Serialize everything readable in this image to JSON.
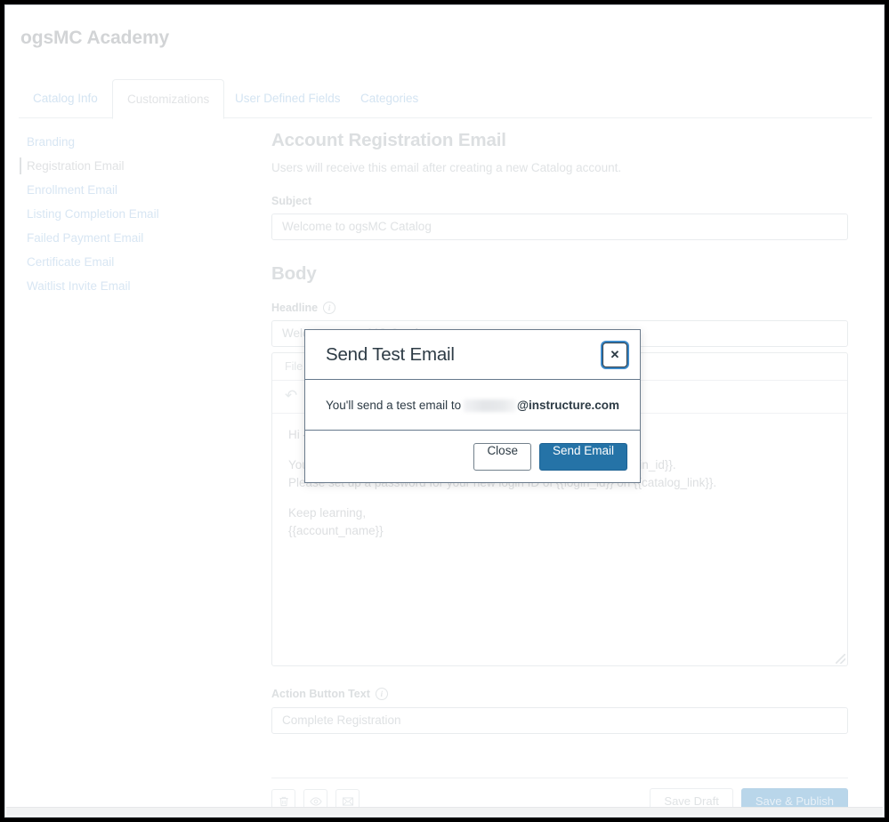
{
  "header": {
    "title": "ogsMC Academy"
  },
  "tabs": [
    {
      "label": "Catalog Info",
      "active": false
    },
    {
      "label": "Customizations",
      "active": true
    },
    {
      "label": "User Defined Fields",
      "active": false
    },
    {
      "label": "Categories",
      "active": false
    }
  ],
  "sidebar": {
    "items": [
      {
        "label": "Branding",
        "active": false
      },
      {
        "label": "Registration Email",
        "active": true
      },
      {
        "label": "Enrollment Email",
        "active": false
      },
      {
        "label": "Listing Completion Email",
        "active": false
      },
      {
        "label": "Failed Payment Email",
        "active": false
      },
      {
        "label": "Certificate Email",
        "active": false
      },
      {
        "label": "Waitlist Invite Email",
        "active": false
      }
    ]
  },
  "main": {
    "page_title": "Account Registration Email",
    "subtitle": "Users will receive this email after creating a new Catalog account.",
    "subject_label": "Subject",
    "subject_value": "Welcome to ogsMC Catalog",
    "body_heading": "Body",
    "headline_label": "Headline",
    "headline_value": "Welcome to ogsMC Catalog",
    "editor": {
      "menu_file": "File",
      "undo_icon": "undo-icon",
      "paragraphs": [
        "Hi {{user_name}},",
        "You have been enrolled in {{catalog_link}} with the login ID of {{login_id}}.\nPlease set up a password for your new login ID of {{login_id}} on {{catalog_link}}.",
        "Keep learning,\n{{account_name}}"
      ]
    },
    "action_button_label": "Action Button Text",
    "action_button_value": "Complete Registration"
  },
  "footer": {
    "icons": [
      {
        "name": "trash-icon"
      },
      {
        "name": "eye-icon"
      },
      {
        "name": "envelope-icon"
      }
    ],
    "save_draft_label": "Save Draft",
    "save_publish_label": "Save & Publish"
  },
  "modal": {
    "title": "Send Test Email",
    "close_icon": "close-icon",
    "message_prefix": "You'll send a test email to",
    "email_redacted": "",
    "email_domain": "@instructure.com",
    "close_label": "Close",
    "send_label": "Send Email"
  },
  "colors": {
    "accent_blue": "#2573a7",
    "focus_ring": "#3b89c9",
    "modal_border": "#66798c",
    "text_dark": "#2d3b45",
    "publish_disabled": "#b9d6ea"
  }
}
